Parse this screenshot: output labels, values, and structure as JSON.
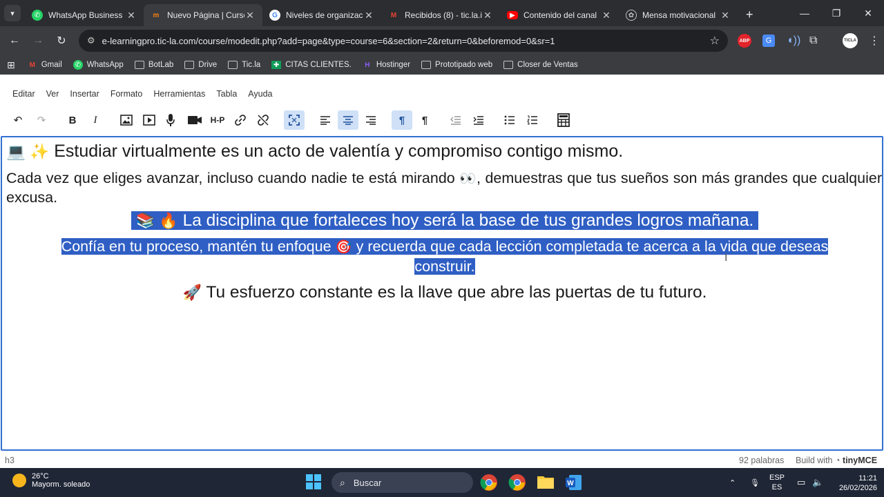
{
  "browser": {
    "tabs": [
      {
        "title": "WhatsApp Business",
        "icon": "whatsapp-icon",
        "color": "#25d366",
        "active": false
      },
      {
        "title": "Nuevo Página | Curso",
        "icon": "moodle-icon",
        "color": "#f98012",
        "active": true
      },
      {
        "title": "Niveles de organizació",
        "icon": "google-icon",
        "color": "#4285f4",
        "active": false
      },
      {
        "title": "Recibidos (8) - tic.la.i",
        "icon": "gmail-icon",
        "color": "#ea4335",
        "active": false
      },
      {
        "title": "Contenido del canal",
        "icon": "youtube-icon",
        "color": "#ff0000",
        "active": false
      },
      {
        "title": "Mensa motivacional",
        "icon": "chatgpt-icon",
        "color": "#bfc3c8",
        "active": false
      }
    ],
    "new_tab_glyph": "+",
    "url": "e-learningpro.tic-la.com/course/modedit.php?add=page&type=course=6&section=2&return=0&beforemod=0&sr=1",
    "bookmarks": [
      {
        "label": "Gmail",
        "icon": "gmail-icon"
      },
      {
        "label": "WhatsApp",
        "icon": "whatsapp-icon"
      },
      {
        "label": "BotLab",
        "icon": "folder-icon"
      },
      {
        "label": "Drive",
        "icon": "folder-icon"
      },
      {
        "label": "Tic.la",
        "icon": "folder-icon"
      },
      {
        "label": "CITAS CLIENTES.",
        "icon": "sheets-icon"
      },
      {
        "label": "Hostinger",
        "icon": "hostinger-icon"
      },
      {
        "label": "Prototipado web",
        "icon": "folder-icon"
      },
      {
        "label": "Closer de Ventas",
        "icon": "folder-icon"
      }
    ],
    "extensions": {
      "abp": "ABP",
      "profile": "TICLA"
    }
  },
  "editor": {
    "menu": [
      "Editar",
      "Ver",
      "Insertar",
      "Formato",
      "Herramientas",
      "Tabla",
      "Ayuda"
    ],
    "toolbar": {
      "undo": "↶",
      "redo": "↷",
      "bold": "B",
      "italic": "I",
      "h5p": "H-P",
      "ltr": "¶",
      "rtl": "¶"
    },
    "content": {
      "line1_emoji": "💻 ✨",
      "line1_text": "Estudiar virtualmente es un acto de valentía y compromiso contigo mismo.",
      "line2_a": "Cada vez que eliges avanzar, incluso cuando nadie te está mirando",
      "line2_emoji": "👀",
      "line2_b": ", demuestras que tus sueños son más grandes que cualquier excusa.",
      "line3_emoji": "📚 🔥",
      "line3_text": "La disciplina que fortaleces hoy será la base de tus grandes logros mañana.",
      "line4_a": "Confía en tu proceso, mantén tu enfoque",
      "line4_emoji": "🎯",
      "line4_b": "y recuerda que cada lección completada te acerca a la vida que deseas",
      "line4_c": "construir.",
      "line5_emoji": "🚀",
      "line5_text": "Tu esfuerzo constante es la llave que abre las puertas de tu futuro."
    },
    "status": {
      "path": "h3",
      "word_count": "92 palabras",
      "built_with": "Build with",
      "brand": "tinyMCE"
    }
  },
  "taskbar": {
    "weather_temp": "26°C",
    "weather_desc": "Mayorm. soleado",
    "search_placeholder": "Buscar",
    "lang_top": "ESP",
    "lang_bottom": "ES",
    "time": "11:21",
    "date": "26/02/2026"
  }
}
